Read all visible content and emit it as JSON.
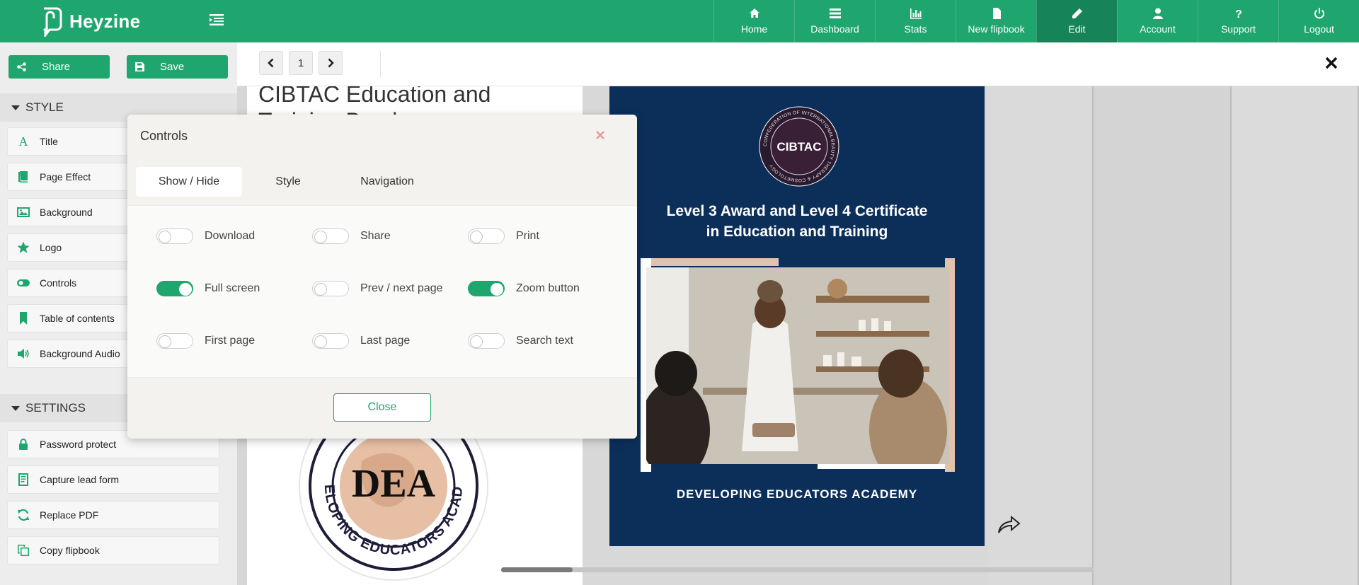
{
  "brand": {
    "name": "Heyzine"
  },
  "nav": {
    "items": [
      {
        "label": "Home",
        "icon": "home-icon"
      },
      {
        "label": "Dashboard",
        "icon": "dashboard-icon"
      },
      {
        "label": "Stats",
        "icon": "stats-icon"
      },
      {
        "label": "New flipbook",
        "icon": "file-icon"
      },
      {
        "label": "Edit",
        "icon": "pencil-icon",
        "active": true
      },
      {
        "label": "Account",
        "icon": "user-icon"
      },
      {
        "label": "Support",
        "icon": "question-icon"
      },
      {
        "label": "Logout",
        "icon": "power-icon"
      }
    ]
  },
  "sidebar": {
    "share_label": "Share",
    "save_label": "Save",
    "style_heading": "STYLE",
    "style_items": [
      {
        "label": "Title",
        "icon": "title-icon"
      },
      {
        "label": "Page Effect",
        "icon": "book-icon"
      },
      {
        "label": "Background",
        "icon": "image-icon"
      },
      {
        "label": "Logo",
        "icon": "star-icon"
      },
      {
        "label": "Controls",
        "icon": "toggle-icon"
      },
      {
        "label": "Table of contents",
        "icon": "bookmark-icon"
      },
      {
        "label": "Background Audio",
        "icon": "volume-icon"
      }
    ],
    "settings_heading": "SETTINGS",
    "settings_items": [
      {
        "label": "Password protect",
        "icon": "lock-icon"
      },
      {
        "label": "Capture lead form",
        "icon": "form-icon"
      },
      {
        "label": "Replace PDF",
        "icon": "refresh-icon"
      },
      {
        "label": "Copy flipbook",
        "icon": "copy-icon"
      }
    ]
  },
  "toolbar": {
    "page_number": "1"
  },
  "flipbook": {
    "left_title_line1": "CIBTAC Education and",
    "left_title_line2": "Training Brochure",
    "seal_top_text": "DEVELOPING EDUCATORS ACADEMY",
    "seal_mono": "DEA",
    "cibtac_badge": "CIBTAC",
    "cibtac_ring": "CONFEDERATION OF INTERNATIONAL BEAUTY THERAPY & COSMETOLOGY",
    "cover_heading_line1": "Level 3 Award and Level 4 Certificate",
    "cover_heading_line2": "in Education and Training",
    "cover_footer": "DEVELOPING EDUCATORS ACADEMY",
    "colors": {
      "cover_bg": "#0c2f5a",
      "accent": "#1fa66e",
      "frame": "#e3c1aa"
    }
  },
  "modal": {
    "title": "Controls",
    "tabs": [
      "Show / Hide",
      "Style",
      "Navigation"
    ],
    "active_tab": "Show / Hide",
    "options": [
      {
        "label": "Download",
        "on": false
      },
      {
        "label": "Share",
        "on": false
      },
      {
        "label": "Print",
        "on": false
      },
      {
        "label": "Full screen",
        "on": true
      },
      {
        "label": "Prev / next page",
        "on": false
      },
      {
        "label": "Zoom button",
        "on": true
      },
      {
        "label": "First page",
        "on": false
      },
      {
        "label": "Last page",
        "on": false
      },
      {
        "label": "Search text",
        "on": false
      }
    ],
    "close_label": "Close"
  }
}
